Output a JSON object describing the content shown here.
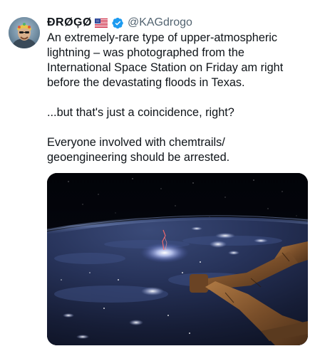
{
  "tweet": {
    "display_name": "ĐRØĢØ",
    "flag_icon": "us-flag-icon",
    "verified_icon": "verified-badge-icon",
    "verified_color": "#1d9bf0",
    "handle": "@KAGdrogo",
    "paragraphs": [
      "An extremely-rare type of upper-atmospheric lightning – was photographed from the International Space Station on Friday am right before the devastating floods in Texas.",
      "...but that's just a coincidence, right?",
      "Everyone involved with chemtrails/ geoengineering should be arrested."
    ],
    "media_description_icon": "earth-from-space-photo"
  }
}
